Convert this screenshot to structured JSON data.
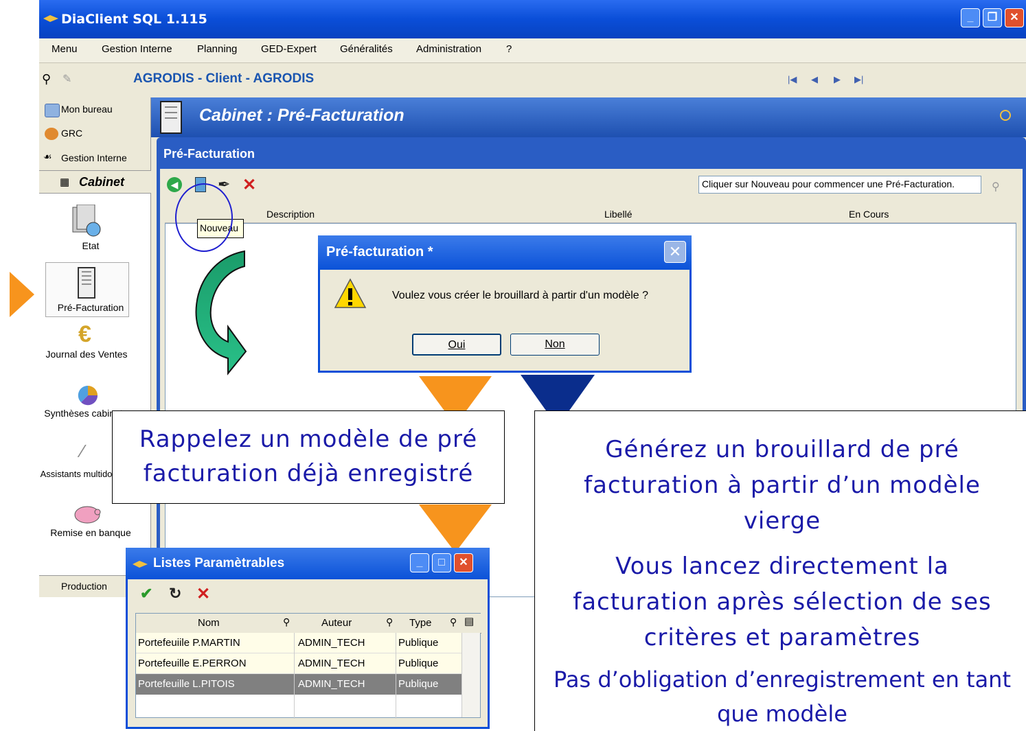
{
  "window": {
    "title": "DiaClient SQL 1.115"
  },
  "menu": [
    "Menu",
    "Gestion Interne",
    "Planning",
    "GED-Expert",
    "Généralités",
    "Administration",
    "?"
  ],
  "client_label": "AGRODIS - Client - AGRODIS",
  "sidebar": {
    "top_items": [
      "Mon bureau",
      "GRC",
      "Gestion Interne"
    ],
    "section": "Cabinet",
    "nav": [
      "Etat",
      "Pré-Facturation",
      "Journal des Ventes",
      "Synthèses cabinets",
      "Assistants multidossiers",
      "Remise en banque"
    ],
    "bottom": "Production"
  },
  "cabinet_header": "Cabinet : Pré-Facturation",
  "panel": {
    "title": "Pré-Facturation",
    "hint": "Cliquer sur Nouveau pour commencer une Pré-Facturation.",
    "columns": [
      "Description",
      "Libellé",
      "En Cours"
    ],
    "tooltip": "Nouveau"
  },
  "dialog": {
    "title": "Pré-facturation  *",
    "message": "Voulez vous créer le brouillard à partir d'un modèle ?",
    "yes": "Oui",
    "no": "Non"
  },
  "callout_left": "Rappelez un modèle de pré facturation déjà enregistré",
  "callout_right": {
    "p1": "Générez un brouillard de pré facturation à partir d’un modèle vierge",
    "p2": "Vous lancez directement la facturation après sélection de ses critères et paramètres",
    "p3": "Pas d’obligation d’enregistrement en tant que modèle"
  },
  "list_window": {
    "title": "Listes Paramètrables",
    "columns": [
      "Nom",
      "Auteur",
      "Type"
    ],
    "rows": [
      [
        "Portefeuiile P.MARTIN",
        "ADMIN_TECH",
        "Publique"
      ],
      [
        "Portefeuille E.PERRON",
        "ADMIN_TECH",
        "Publique"
      ],
      [
        "Portefeuille L.PITOIS",
        "ADMIN_TECH",
        "Publique"
      ]
    ]
  },
  "colors": {
    "accent_orange": "#f7941d",
    "dark_blue": "#0a2d8c",
    "callout_text": "#1a1aa8",
    "xp_blue": "#0a4ed8"
  }
}
